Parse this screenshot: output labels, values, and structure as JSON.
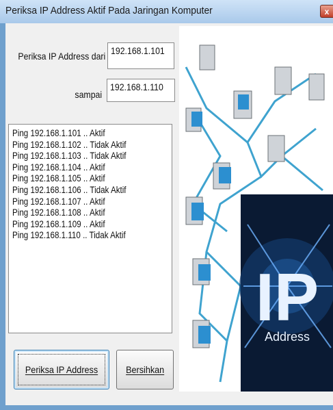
{
  "window": {
    "title": "Periksa IP Address Aktif Pada Jaringan Komputer",
    "close_label": "x"
  },
  "form": {
    "from_label": "Periksa IP Address dari",
    "from_value": "192.168.1.101",
    "to_label": "sampai",
    "to_value": "192.168.1.110"
  },
  "results": [
    "Ping 192.168.1.101 .. Aktif",
    "Ping 192.168.1.102 .. Tidak Aktif",
    "Ping 192.168.1.103 .. Tidak Aktif",
    "Ping 192.168.1.104 .. Aktif",
    "Ping 192.168.1.105 .. Aktif",
    "Ping 192.168.1.106 .. Tidak Aktif",
    "Ping 192.168.1.107 .. Aktif",
    "Ping 192.168.1.108 .. Aktif",
    "Ping 192.168.1.109 .. Aktif",
    "Ping 192.168.1.110 .. Tidak Aktif"
  ],
  "buttons": {
    "check_label": "Periksa IP Address",
    "clear_label": "Bersihkan"
  },
  "illustration": {
    "ip_text": "IP",
    "address_text": "Address"
  },
  "colors": {
    "frame": "#6fa0cd",
    "network_line": "#3fa3cf",
    "ip_panel": "#0a1a33"
  }
}
